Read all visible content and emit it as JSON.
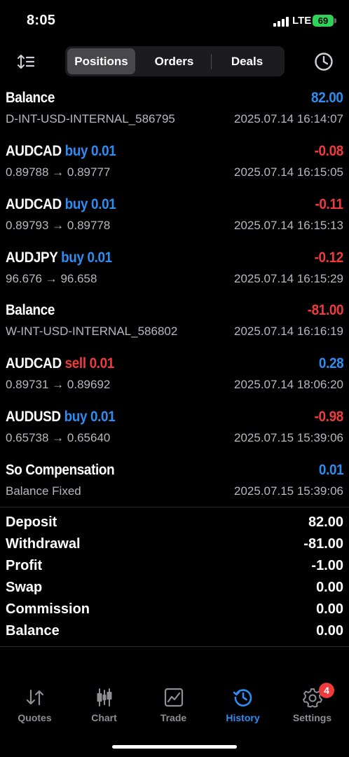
{
  "status_bar": {
    "time": "8:05",
    "network": "LTE",
    "battery": "69"
  },
  "toolbar": {
    "tabs": [
      {
        "label": "Positions",
        "active": true
      },
      {
        "label": "Orders",
        "active": false
      },
      {
        "label": "Deals",
        "active": false
      }
    ],
    "left_icon": "sort-icon",
    "right_icon": "clock-icon"
  },
  "deals": [
    {
      "symbol": "Balance",
      "side": "",
      "volume": "",
      "amount": "82.00",
      "amount_color": "blue",
      "subtitle": "D-INT-USD-INTERNAL_586795",
      "time": "2025.07.14 16:14:07"
    },
    {
      "symbol": "AUDCAD",
      "side": "buy",
      "volume": "0.01",
      "amount": "-0.08",
      "amount_color": "red",
      "subtitle": "0.89788 → 0.89777",
      "time": "2025.07.14 16:15:05"
    },
    {
      "symbol": "AUDCAD",
      "side": "buy",
      "volume": "0.01",
      "amount": "-0.11",
      "amount_color": "red",
      "subtitle": "0.89793 → 0.89778",
      "time": "2025.07.14 16:15:13"
    },
    {
      "symbol": "AUDJPY",
      "side": "buy",
      "volume": "0.01",
      "amount": "-0.12",
      "amount_color": "red",
      "subtitle": "96.676 → 96.658",
      "time": "2025.07.14 16:15:29"
    },
    {
      "symbol": "Balance",
      "side": "",
      "volume": "",
      "amount": "-81.00",
      "amount_color": "red",
      "subtitle": "W-INT-USD-INTERNAL_586802",
      "time": "2025.07.14 16:16:19"
    },
    {
      "symbol": "AUDCAD",
      "side": "sell",
      "volume": "0.01",
      "amount": "0.28",
      "amount_color": "blue",
      "subtitle": "0.89731 → 0.89692",
      "time": "2025.07.14 18:06:20"
    },
    {
      "symbol": "AUDUSD",
      "side": "buy",
      "volume": "0.01",
      "amount": "-0.98",
      "amount_color": "red",
      "subtitle": "0.65738 → 0.65640",
      "time": "2025.07.15 15:39:06"
    },
    {
      "symbol": "So Compensation",
      "side": "",
      "volume": "",
      "amount": "0.01",
      "amount_color": "blue",
      "subtitle": "Balance Fixed",
      "time": "2025.07.15 15:39:06"
    }
  ],
  "summary": [
    {
      "label": "Deposit",
      "value": "82.00"
    },
    {
      "label": "Withdrawal",
      "value": "-81.00"
    },
    {
      "label": "Profit",
      "value": "-1.00"
    },
    {
      "label": "Swap",
      "value": "0.00"
    },
    {
      "label": "Commission",
      "value": "0.00"
    },
    {
      "label": "Balance",
      "value": "0.00"
    }
  ],
  "tabbar": [
    {
      "label": "Quotes",
      "icon": "quotes-icon",
      "active": false
    },
    {
      "label": "Chart",
      "icon": "chart-icon",
      "active": false
    },
    {
      "label": "Trade",
      "icon": "trade-icon",
      "active": false
    },
    {
      "label": "History",
      "icon": "history-icon",
      "active": true
    },
    {
      "label": "Settings",
      "icon": "settings-icon",
      "active": false,
      "badge": "4"
    }
  ],
  "colors": {
    "blue": "#2f8cf0",
    "red": "#ef3b3b",
    "gray": "#8e8e93",
    "battery": "#30d158"
  }
}
